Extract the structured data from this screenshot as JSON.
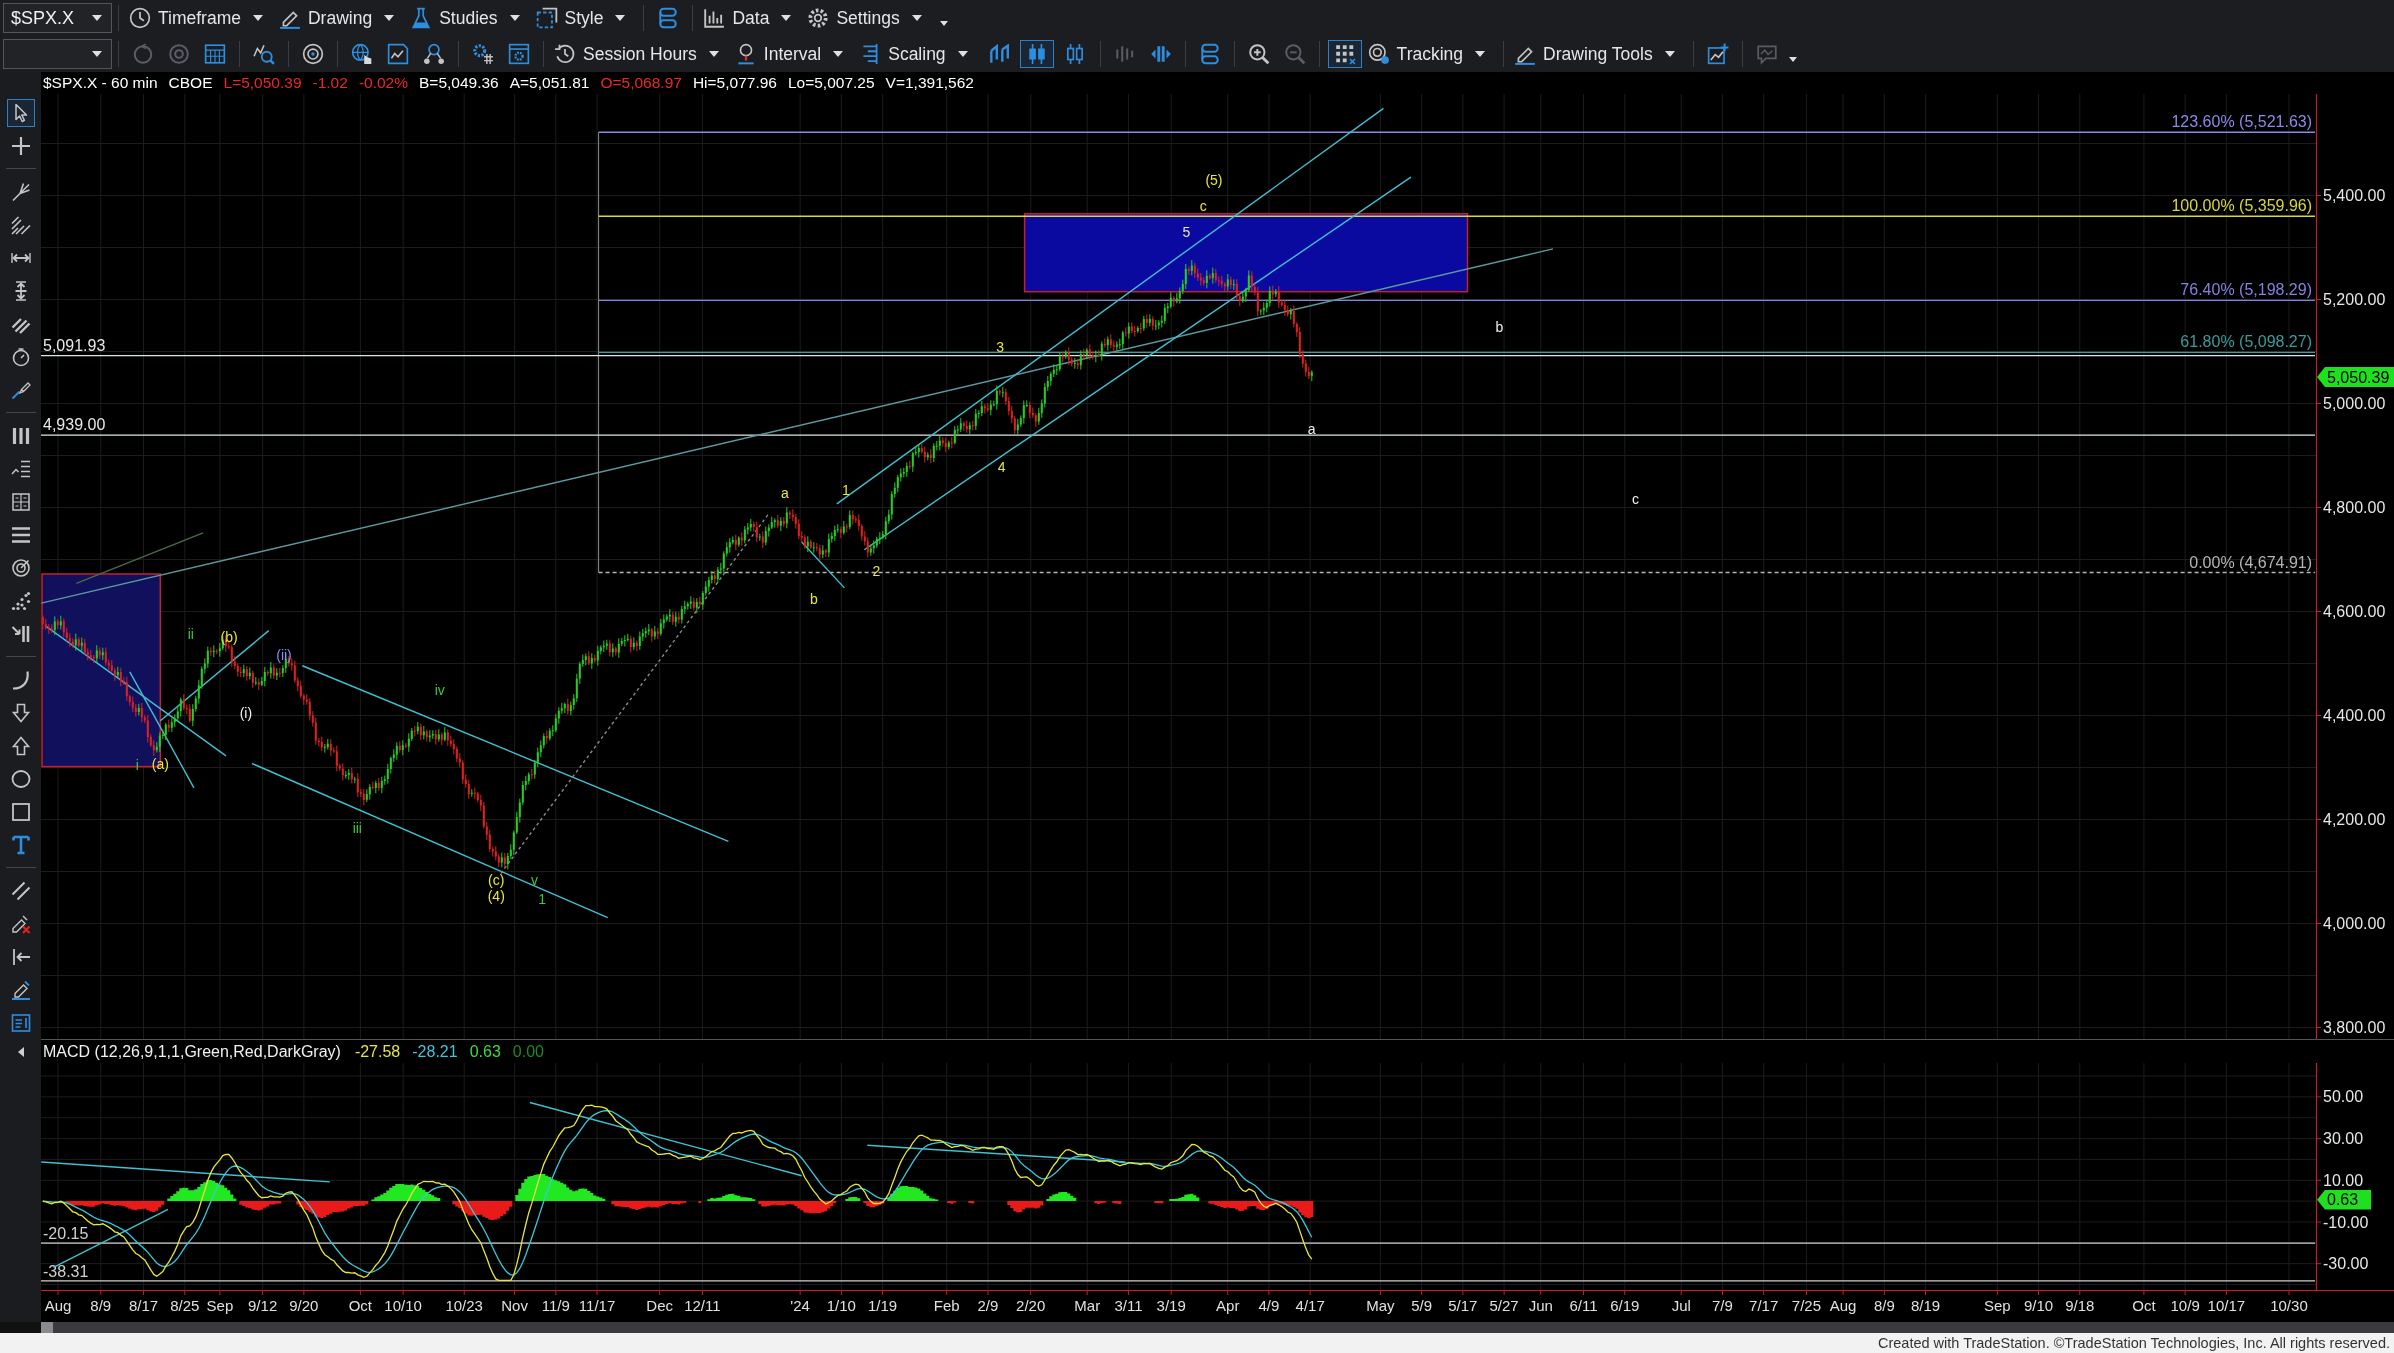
{
  "toolbar": {
    "symbol": "$SPX.X",
    "menus": [
      {
        "label": "Timeframe"
      },
      {
        "label": "Drawing"
      },
      {
        "label": "Studies"
      },
      {
        "label": "Style"
      },
      {
        "label": "Data"
      },
      {
        "label": "Settings"
      }
    ]
  },
  "toolbar_2": {
    "menus": [
      {
        "label": "Session Hours"
      },
      {
        "label": "Interval"
      },
      {
        "label": "Scaling"
      },
      {
        "label": "Tracking"
      },
      {
        "label": "Drawing Tools"
      }
    ],
    "chart_styles": [
      {
        "selected": false
      },
      {
        "selected": true
      },
      {
        "selected": false
      }
    ],
    "grid": {
      "selected": true
    }
  },
  "quote_line": [
    {
      "text": "$SPX.X - 60 min",
      "color": "#ffffff"
    },
    {
      "text": "CBOE",
      "color": "#ffffff"
    },
    {
      "text": "L=5,050.39",
      "color": "#e82828"
    },
    {
      "text": "-1.02",
      "color": "#e82828"
    },
    {
      "text": "-0.02%",
      "color": "#e82828"
    },
    {
      "text": "B=5,049.36",
      "color": "#ffffff"
    },
    {
      "text": "A=5,051.81",
      "color": "#ffffff"
    },
    {
      "text": "O=5,068.97",
      "color": "#e82828"
    },
    {
      "text": "Hi=5,077.96",
      "color": "#ffffff"
    },
    {
      "text": "Lo=5,007.25",
      "color": "#ffffff"
    },
    {
      "text": "V=1,391,562",
      "color": "#ffffff"
    }
  ],
  "drawing_tools": [
    {
      "selected": true
    },
    {
      "selected": false
    },
    {
      "selected": false
    },
    {
      "selected": false
    },
    {
      "selected": false
    },
    {
      "selected": false
    },
    {
      "selected": false
    },
    {
      "selected": false
    },
    {
      "selected": false
    },
    {
      "selected": false
    },
    {
      "selected": false
    },
    {
      "selected": false
    },
    {
      "selected": false
    },
    {
      "selected": false
    },
    {
      "selected": false
    },
    {
      "selected": false
    },
    {
      "selected": false
    },
    {
      "selected": false
    },
    {
      "selected": false
    },
    {
      "selected": false
    },
    {
      "selected": false
    },
    {
      "selected": false
    },
    {
      "selected": false
    },
    {
      "selected": false
    },
    {
      "selected": false
    },
    {
      "selected": false
    },
    {
      "selected": false
    }
  ],
  "price_chart": {
    "fib_levels": [
      {
        "label": "123.60% (5,521.63)",
        "color": "#8a8ae8",
        "kind": "solid"
      },
      {
        "label": "100.00% (5,359.96)",
        "color": "#d8d83c",
        "kind": "solid"
      },
      {
        "label": "76.40% (5,198.29)",
        "color": "#8282e0",
        "kind": "solid"
      },
      {
        "label": "61.80% (5,098.27)",
        "color": "#3c9c9c",
        "kind": "solid"
      },
      {
        "label": "0.00% (4,674.91)",
        "color": "#b4b4b4",
        "kind": "dotted"
      }
    ],
    "levels": [
      {
        "label": "5,091.93"
      },
      {
        "label": "4,939.00"
      }
    ],
    "wave_labels": [
      {
        "text": "(5)",
        "color": "#e8e83c"
      },
      {
        "text": "c",
        "color": "#e8e83c"
      },
      {
        "text": "5",
        "color": "#e8e8a8"
      },
      {
        "text": "b",
        "color": "#f0f0f0"
      },
      {
        "text": "3",
        "color": "#e8e83c"
      },
      {
        "text": "a",
        "color": "#f0f0f0"
      },
      {
        "text": "4",
        "color": "#e8e83c"
      },
      {
        "text": "1",
        "color": "#e8e83c"
      },
      {
        "text": "a",
        "color": "#e8e83c"
      },
      {
        "text": "c",
        "color": "#f0f0f0"
      },
      {
        "text": "2",
        "color": "#e8e83c"
      },
      {
        "text": "b",
        "color": "#e8e83c"
      },
      {
        "text": "ii",
        "color": "#3cc83c"
      },
      {
        "text": "(b)",
        "color": "#e8e83c"
      },
      {
        "text": "(ii)",
        "color": "#8c8cff"
      },
      {
        "text": "iv",
        "color": "#3cc83c"
      },
      {
        "text": "(i)",
        "color": "#f0f0f0"
      },
      {
        "text": "i",
        "color": "#3cc83c"
      },
      {
        "text": "(a)",
        "color": "#e8e83c"
      },
      {
        "text": "iii",
        "color": "#3cc83c"
      },
      {
        "text": "(c)",
        "color": "#e8e83c"
      },
      {
        "text": "v",
        "color": "#3cc83c"
      },
      {
        "text": "(4)",
        "color": "#e8e83c"
      },
      {
        "text": "1",
        "color": "#3cc83c"
      }
    ],
    "price_axis": [
      "5,400.00",
      "5,200.00",
      "5,000.00",
      "4,800.00",
      "4,600.00",
      "4,400.00",
      "4,200.00",
      "4,000.00",
      "3,800.00"
    ],
    "last_price": "5,050.39"
  },
  "macd": {
    "title": "MACD (12,26,9,1,1,Green,Red,DarkGray)",
    "values": [
      {
        "text": "-27.58",
        "color": "#e6e63c"
      },
      {
        "text": "-28.21",
        "color": "#3cc8dc"
      },
      {
        "text": "0.63",
        "color": "#3cdc3c"
      },
      {
        "text": "0.00",
        "color": "#1e8c1e"
      }
    ],
    "levels": [
      {
        "label": "-20.15"
      },
      {
        "label": "-38.31"
      }
    ],
    "axis": [
      "50.00",
      "30.00",
      "10.00",
      "-10.00",
      "-30.00"
    ],
    "last_value": "0.63"
  },
  "time_axis": [
    "Aug",
    "8/9",
    "8/17",
    "8/25",
    "Sep",
    "9/12",
    "9/20",
    "Oct",
    "10/10",
    "10/23",
    "Nov",
    "11/9",
    "11/17",
    "Dec",
    "12/11",
    "'24",
    "1/10",
    "1/19",
    "Feb",
    "2/9",
    "2/20",
    "Mar",
    "3/11",
    "3/19",
    "Apr",
    "4/9",
    "4/17",
    "May",
    "5/9",
    "5/17",
    "5/27",
    "Jun",
    "6/11",
    "6/19",
    "Jul",
    "7/9",
    "7/17",
    "7/25",
    "Aug",
    "8/9",
    "8/19",
    "Sep",
    "9/10",
    "9/18",
    "Oct",
    "10/9",
    "10/17",
    "10/30"
  ],
  "footer": "Created with TradeStation. ©TradeStation Technologies, Inc. All rights reserved."
}
